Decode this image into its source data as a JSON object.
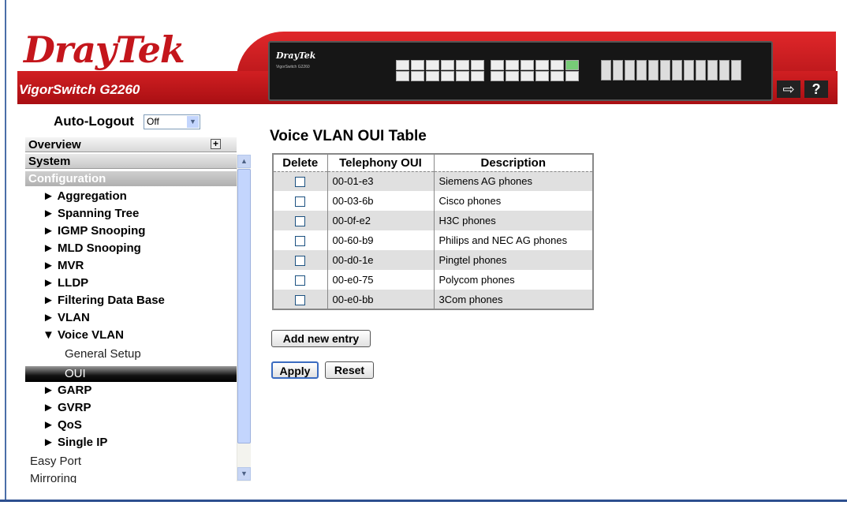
{
  "header": {
    "brand_dray": "Dray",
    "brand_tek": "Tek",
    "model": "VigorSwitch G2260",
    "device_brand": "DrayTek",
    "device_model": "VigorSwitch G2260",
    "logout_icon": "logout-icon",
    "help_label": "?"
  },
  "sidebar": {
    "autologout_label": "Auto-Logout",
    "autologout_value": "Off",
    "overview": "Overview",
    "system": "System",
    "configuration": "Configuration",
    "items": [
      "► Aggregation",
      "► Spanning Tree",
      "► IGMP Snooping",
      "► MLD Snooping",
      "► MVR",
      "► LLDP",
      "► Filtering Data Base",
      "► VLAN",
      "▼ Voice VLAN"
    ],
    "voice_vlan_children": [
      "General Setup",
      "OUI"
    ],
    "items_after": [
      "► GARP",
      "► GVRP",
      "► QoS",
      "► Single IP"
    ],
    "top_items": [
      "Easy Port",
      "Mirroring"
    ]
  },
  "main": {
    "title": "Voice VLAN OUI Table",
    "columns": [
      "Delete",
      "Telephony OUI",
      "Description"
    ],
    "rows": [
      {
        "oui": "00-01-e3",
        "description": "Siemens AG phones"
      },
      {
        "oui": "00-03-6b",
        "description": "Cisco phones"
      },
      {
        "oui": "00-0f-e2",
        "description": "H3C phones"
      },
      {
        "oui": "00-60-b9",
        "description": "Philips and NEC AG phones"
      },
      {
        "oui": "00-d0-1e",
        "description": "Pingtel phones"
      },
      {
        "oui": "00-e0-75",
        "description": "Polycom phones"
      },
      {
        "oui": "00-e0-bb",
        "description": "3Com phones"
      }
    ],
    "add_button": "Add new entry",
    "apply_button": "Apply",
    "reset_button": "Reset"
  },
  "colors": {
    "brand_red": "#c4161c",
    "selected_bg": "#000000",
    "row_alt": "#e0e0e0"
  }
}
